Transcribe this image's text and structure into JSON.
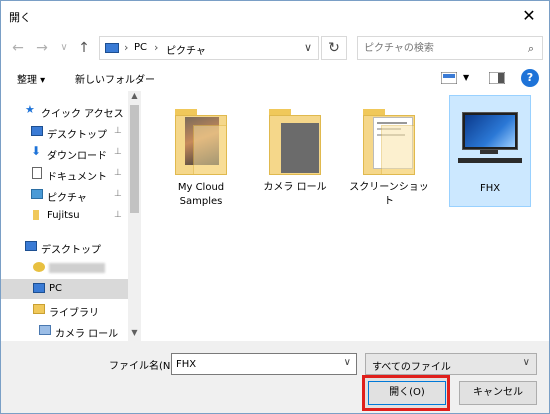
{
  "window": {
    "title": "開く",
    "close_glyph": "✕"
  },
  "nav": {
    "back_glyph": "←",
    "forward_glyph": "→",
    "recent_glyph": "∨",
    "up_glyph": "↑",
    "breadcrumb": [
      "PC",
      "ピクチャ"
    ],
    "separator": "›",
    "refresh_glyph": "↻",
    "search_placeholder": "ピクチャの検索",
    "search_glyph": "⌕"
  },
  "toolbar": {
    "organize_label": "整理 ▾",
    "new_folder_label": "新しいフォルダー",
    "help_label": "?"
  },
  "sidebar": {
    "items": [
      {
        "label": "クイック アクセス",
        "icon": "star-icon",
        "pinned": false,
        "selected": false
      },
      {
        "label": "デスクトップ",
        "icon": "desktop-icon",
        "pinned": true,
        "selected": false
      },
      {
        "label": "ダウンロード",
        "icon": "download-icon",
        "pinned": true,
        "selected": false
      },
      {
        "label": "ドキュメント",
        "icon": "document-icon",
        "pinned": true,
        "selected": false
      },
      {
        "label": "ピクチャ",
        "icon": "pictures-icon",
        "pinned": true,
        "selected": false
      },
      {
        "label": "Fujitsu",
        "icon": "folder-icon",
        "pinned": true,
        "selected": false
      },
      {
        "label": "デスクトップ",
        "icon": "desktop-icon",
        "pinned": false,
        "selected": false
      },
      {
        "label": "",
        "icon": "user-icon",
        "pinned": false,
        "selected": false
      },
      {
        "label": "PC",
        "icon": "pc-icon",
        "pinned": false,
        "selected": true
      },
      {
        "label": "ライブラリ",
        "icon": "library-icon",
        "pinned": false,
        "selected": false
      },
      {
        "label": "カメラ ロール",
        "icon": "camera-roll-icon",
        "pinned": false,
        "selected": false
      }
    ],
    "pin_glyph": "📌",
    "scroll_up_glyph": "▲",
    "scroll_down_glyph": "▼"
  },
  "files": [
    {
      "label": "My Cloud Samples",
      "type": "folder-photos"
    },
    {
      "label": "カメラ ロール",
      "type": "folder-gray"
    },
    {
      "label": "スクリーンショット",
      "type": "folder-screens"
    },
    {
      "label": "FHX",
      "type": "image-pc"
    }
  ],
  "footer": {
    "filename_label": "ファイル名(N):",
    "filename_value": "FHX",
    "filetype_value": "すべてのファイル",
    "open_label": "開く(O)",
    "cancel_label": "キャンセル",
    "dropdown_glyph": "∨"
  },
  "colors": {
    "accent": "#0078d7",
    "highlight_box": "#e0201c",
    "selection": "#cce8ff"
  }
}
